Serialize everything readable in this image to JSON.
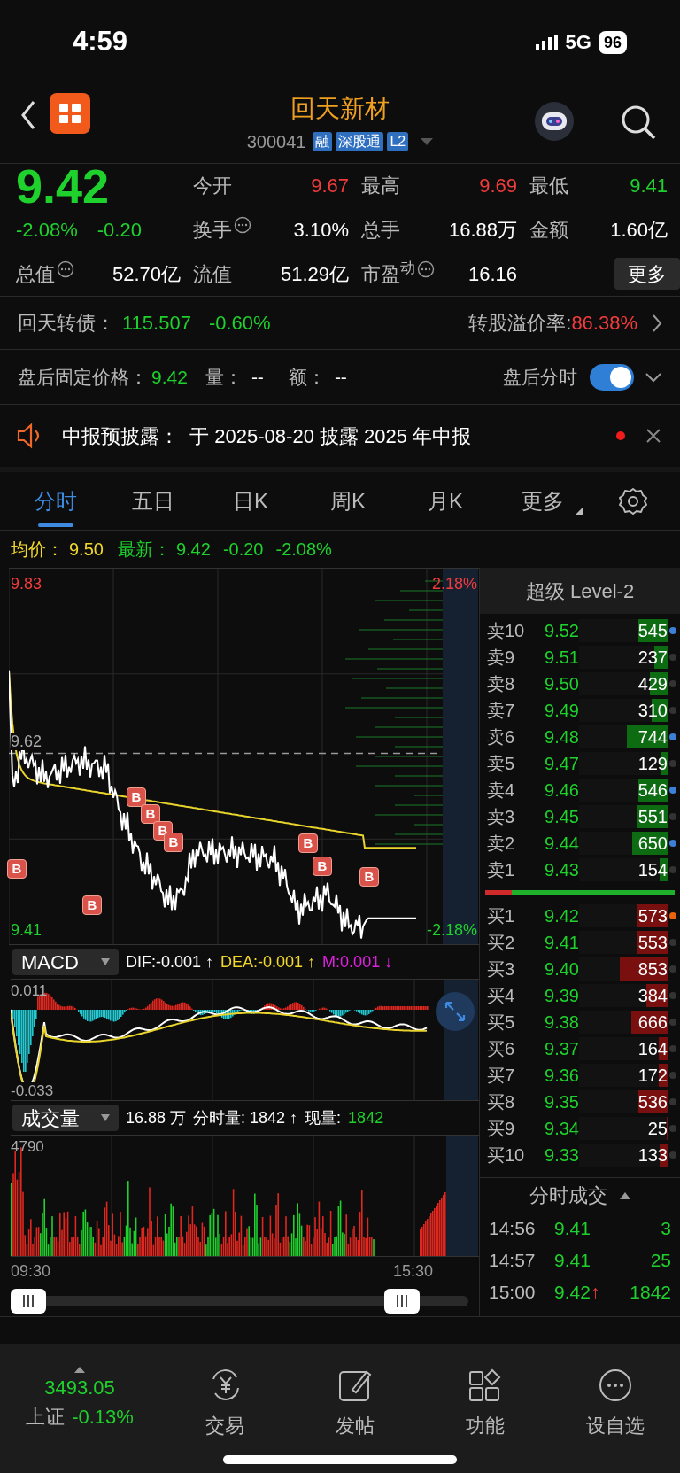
{
  "status_bar": {
    "time": "4:59",
    "network": "5G",
    "battery": "96"
  },
  "header": {
    "title": "回天新材",
    "code": "300041",
    "tags": [
      "融",
      "深股通",
      "L2"
    ]
  },
  "quote": {
    "price": "9.42",
    "change_pct": "-2.08%",
    "change": "-0.20",
    "more_button": "更多",
    "stats": [
      {
        "label": "今开",
        "value": "9.67",
        "color": "#f23c3c",
        "info": false
      },
      {
        "label": "最高",
        "value": "9.69",
        "color": "#f23c3c",
        "info": false
      },
      {
        "label": "最低",
        "value": "9.41",
        "color": "#1fd12c",
        "info": false
      },
      {
        "label": "换手",
        "value": "3.10%",
        "color": "#ffffff",
        "info": true
      },
      {
        "label": "总手",
        "value": "16.88万",
        "color": "#ffffff",
        "info": false
      },
      {
        "label": "金额",
        "value": "1.60亿",
        "color": "#ffffff",
        "info": false
      },
      {
        "label": "总值",
        "value": "52.70亿",
        "color": "#ffffff",
        "info": true
      },
      {
        "label": "流值",
        "value": "51.29亿",
        "color": "#ffffff",
        "info": false
      },
      {
        "label": "市盈$^{动}$",
        "value": "16.16",
        "color": "#ffffff",
        "info": true
      }
    ]
  },
  "convertible": {
    "label": "回天转债：",
    "price": "115.507",
    "change": "-0.60%",
    "premium_label": "转股溢价率:",
    "premium": "86.38%"
  },
  "after_hours": {
    "label": "盘后固定价格：",
    "price": "9.42",
    "volume_label": "量：",
    "volume": "--",
    "amount_label": "额：",
    "amount": "--",
    "toggle_label": "盘后分时",
    "toggle_on": true
  },
  "notice": {
    "text": "中报预披露：  于 2025-08-20 披露 2025 年中报",
    "unread": true
  },
  "tabs": [
    {
      "label": "分时",
      "selected": true,
      "dropdown": false
    },
    {
      "label": "五日",
      "selected": false,
      "dropdown": false
    },
    {
      "label": "日K",
      "selected": false,
      "dropdown": false
    },
    {
      "label": "周K",
      "selected": false,
      "dropdown": false
    },
    {
      "label": "月K",
      "selected": false,
      "dropdown": false
    },
    {
      "label": "更多",
      "selected": false,
      "dropdown": true
    }
  ],
  "summary": {
    "avg_label": "均价：",
    "avg": "9.50",
    "latest_label": "最新：",
    "latest": "9.42",
    "change": "-0.20",
    "change_pct": "-2.08%"
  },
  "price_chart": {
    "y_max": "9.83",
    "y_mid": "9.62",
    "y_min": "9.41",
    "pct_max": "2.18%",
    "pct_min": "-2.18%",
    "markers": [
      "B",
      "B",
      "B",
      "B",
      "B",
      "B",
      "B",
      "B",
      "B"
    ]
  },
  "macd": {
    "selector": "MACD",
    "dif": "DIF:-0.001 ↑",
    "dea": "DEA:-0.001 ↑",
    "m": "M:0.001 ↓",
    "y_max": "0.011",
    "y_min": "-0.033"
  },
  "volume": {
    "selector": "成交量",
    "total": "16.88 万",
    "period": "分时量: 1842 ↑",
    "current_label": "现量:",
    "current": "1842",
    "y_max": "4790"
  },
  "time_axis": [
    "09:30",
    "15:30"
  ],
  "order_book": {
    "title": "超级 Level-2",
    "balance": {
      "level": 0.14
    },
    "asks": [
      {
        "label": "卖10",
        "price": "9.52",
        "volume": "545",
        "level": 0.33,
        "color": "#3d7fd6"
      },
      {
        "label": "卖9",
        "price": "9.51",
        "volume": "237",
        "level": 0.15,
        "color": "#333333"
      },
      {
        "label": "卖8",
        "price": "9.50",
        "volume": "429",
        "level": 0.2,
        "color": "#333333"
      },
      {
        "label": "卖7",
        "price": "9.49",
        "volume": "310",
        "level": 0.18,
        "color": "#333333"
      },
      {
        "label": "卖6",
        "price": "9.48",
        "volume": "744",
        "level": 0.46,
        "color": "#3d7fd6"
      },
      {
        "label": "卖5",
        "price": "9.47",
        "volume": "129",
        "level": 0.08,
        "color": "#333333"
      },
      {
        "label": "卖4",
        "price": "9.46",
        "volume": "546",
        "level": 0.33,
        "color": "#3d7fd6"
      },
      {
        "label": "卖3",
        "price": "9.45",
        "volume": "551",
        "level": 0.34,
        "color": "#333333"
      },
      {
        "label": "卖2",
        "price": "9.44",
        "volume": "650",
        "level": 0.4,
        "color": "#3d7fd6"
      },
      {
        "label": "卖1",
        "price": "9.43",
        "volume": "154",
        "level": 0.09,
        "color": "#333333"
      }
    ],
    "bids": [
      {
        "label": "买1",
        "price": "9.42",
        "volume": "573",
        "level": 0.35,
        "color": "#e8630a"
      },
      {
        "label": "买2",
        "price": "9.41",
        "volume": "553",
        "level": 0.34,
        "color": "#333333"
      },
      {
        "label": "买3",
        "price": "9.40",
        "volume": "853",
        "level": 0.54,
        "color": "#333333"
      },
      {
        "label": "买4",
        "price": "9.39",
        "volume": "384",
        "level": 0.24,
        "color": "#333333"
      },
      {
        "label": "买5",
        "price": "9.38",
        "volume": "666",
        "level": 0.41,
        "color": "#333333"
      },
      {
        "label": "买6",
        "price": "9.37",
        "volume": "164",
        "level": 0.1,
        "color": "#333333"
      },
      {
        "label": "买7",
        "price": "9.36",
        "volume": "172",
        "level": 0.1,
        "color": "#333333"
      },
      {
        "label": "买8",
        "price": "9.35",
        "volume": "536",
        "level": 0.33,
        "color": "#333333"
      },
      {
        "label": "买9",
        "price": "9.34",
        "volume": "25",
        "level": 0.01,
        "color": "#333333"
      },
      {
        "label": "买10",
        "price": "9.33",
        "volume": "133",
        "level": 0.09,
        "color": "#333333"
      }
    ]
  },
  "trades": {
    "title": "分时成交",
    "rows": [
      {
        "time": "14:56",
        "price": "9.41",
        "volume": "3"
      },
      {
        "time": "14:57",
        "price": "9.41",
        "volume": "25"
      },
      {
        "time": "15:00",
        "price": "9.42",
        "arrow": "↑",
        "volume": "1842"
      }
    ]
  },
  "bottom_nav": {
    "index": {
      "value": "3493.05",
      "name": "上证",
      "change": "-0.13%"
    },
    "items": [
      {
        "kind": "trade",
        "label": "交易"
      },
      {
        "kind": "post",
        "label": "发帖"
      },
      {
        "kind": "apps",
        "label": "功能"
      },
      {
        "kind": "more",
        "label": "设自选"
      }
    ]
  }
}
